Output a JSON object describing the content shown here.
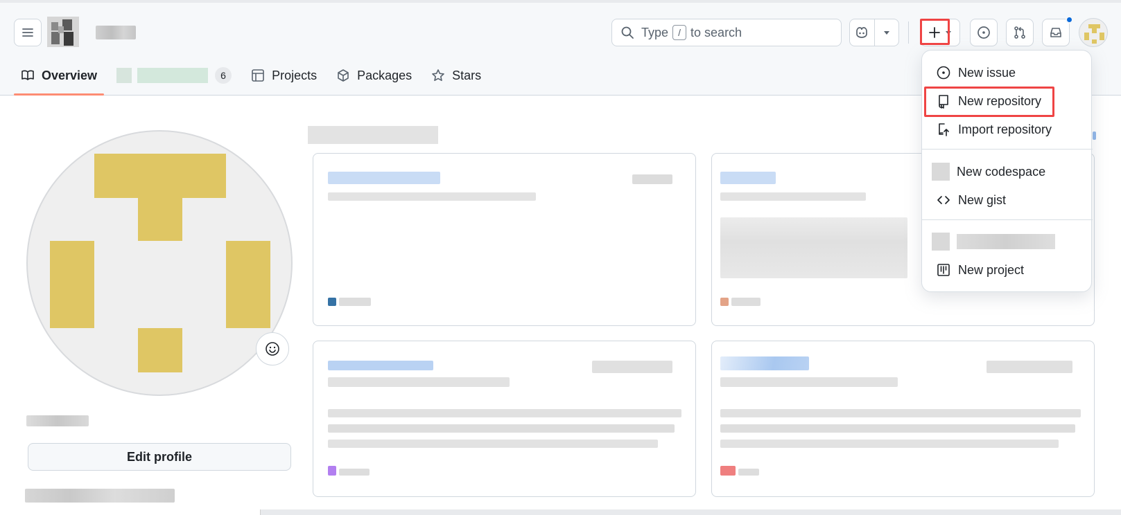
{
  "header": {
    "search_prefix": "Type",
    "search_key": "/",
    "search_suffix": "to search"
  },
  "tabs": [
    {
      "label": "Overview",
      "active": true
    },
    {
      "label": "",
      "count": "6"
    },
    {
      "label": "Projects"
    },
    {
      "label": "Packages"
    },
    {
      "label": "Stars"
    }
  ],
  "profile": {
    "edit_label": "Edit profile"
  },
  "create_menu": {
    "items": [
      {
        "label": "New issue",
        "icon": "issue-opened-icon"
      },
      {
        "label": "New repository",
        "icon": "repo-icon",
        "highlighted": true
      },
      {
        "label": "Import repository",
        "icon": "repo-push-icon"
      },
      {
        "label": "New codespace",
        "icon": "codespace-icon"
      },
      {
        "label": "New gist",
        "icon": "code-icon"
      },
      {
        "label": "",
        "icon": "organization-icon"
      },
      {
        "label": "New project",
        "icon": "project-icon"
      }
    ]
  },
  "colors": {
    "accent_underline": "#fd8c73",
    "highlight_box": "#ef4444",
    "notification_dot": "#0969da",
    "avatar_identicon": "#dfc664"
  }
}
